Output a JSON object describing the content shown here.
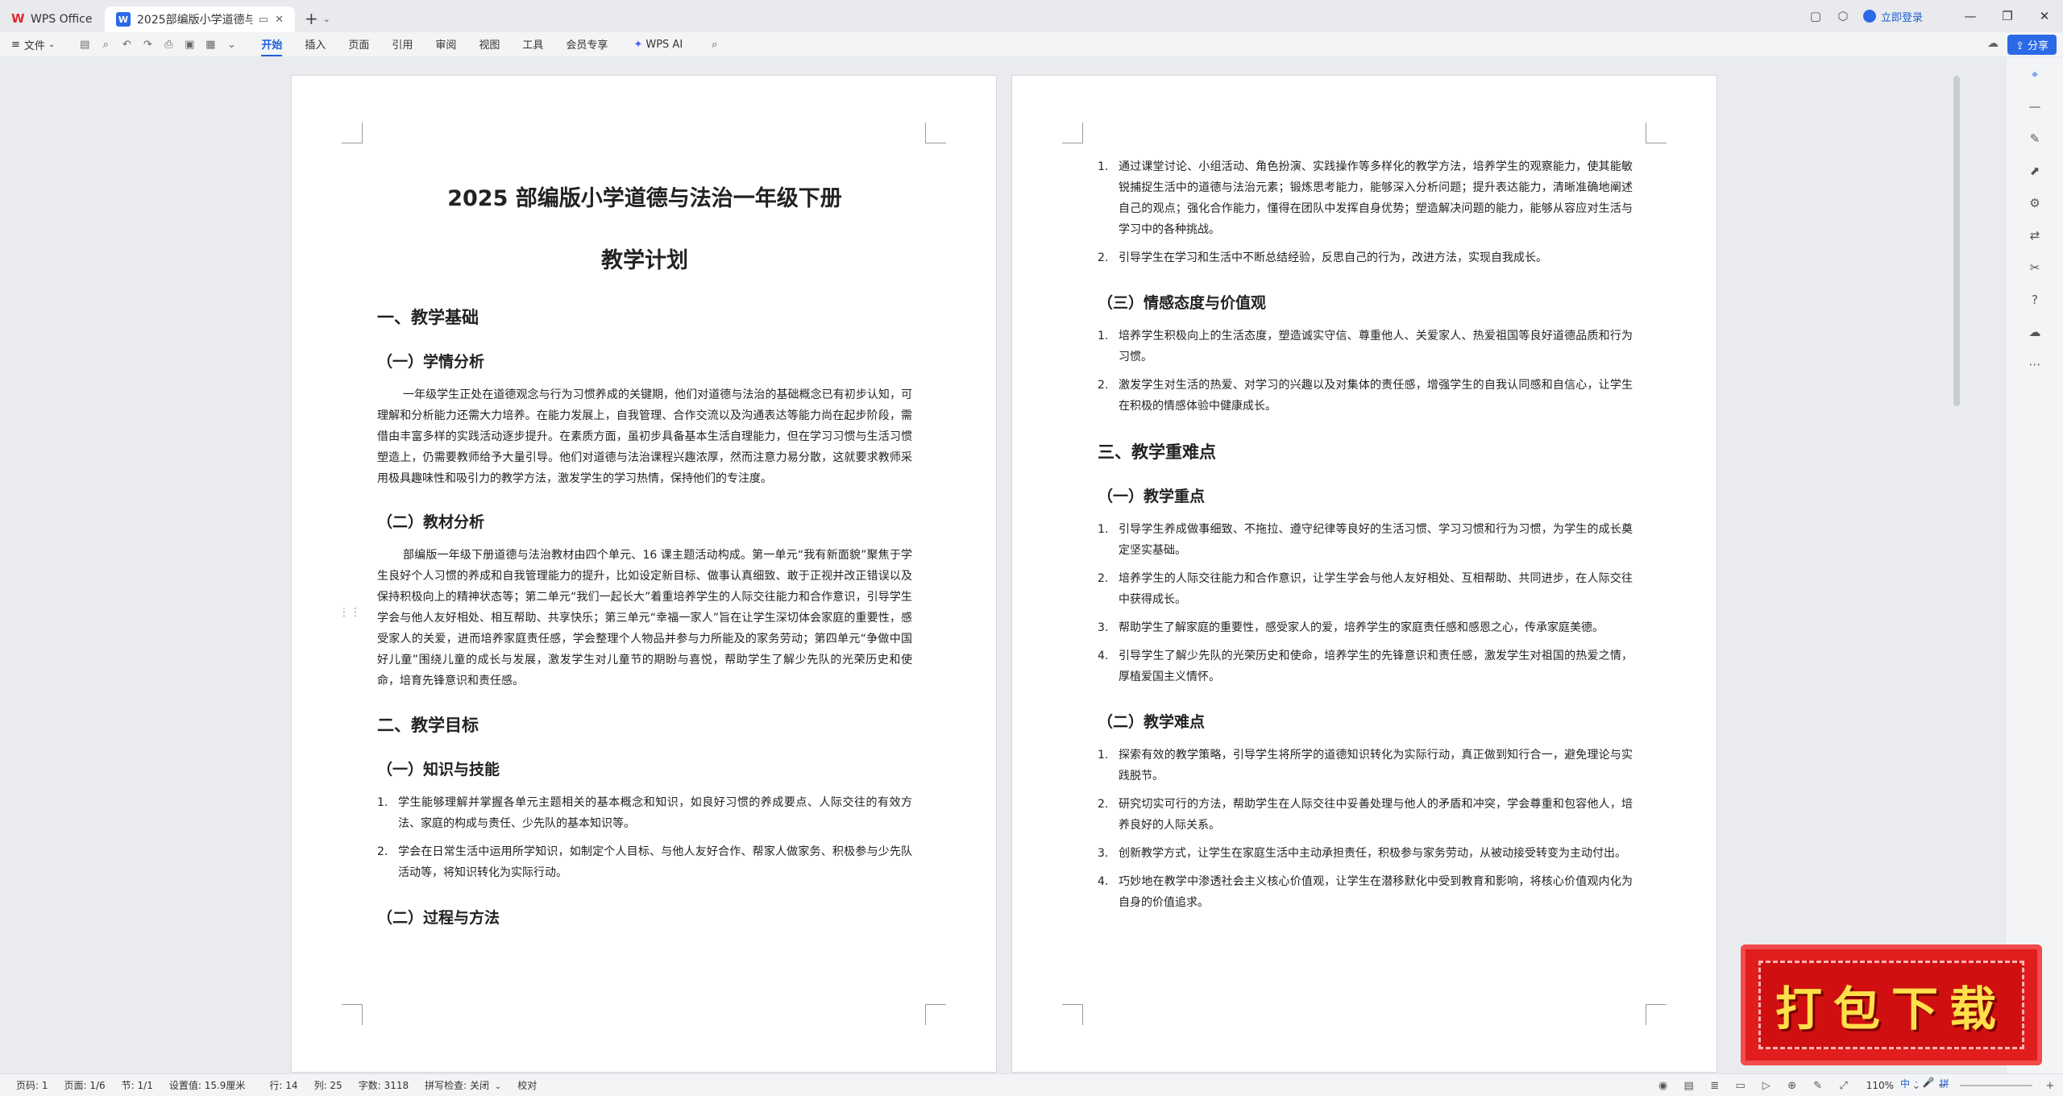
{
  "titlebar": {
    "home_tab": "WPS Office",
    "doc_tab": "2025部编版小学道德与法治",
    "login": "立即登录"
  },
  "toolbar": {
    "file_menu": "文件",
    "menus": [
      "开始",
      "插入",
      "页面",
      "引用",
      "审阅",
      "视图",
      "工具",
      "会员专享"
    ],
    "active_menu": "开始",
    "wps_ai": "WPS AI",
    "share": "分享"
  },
  "page1": {
    "title_line1": "2025 部编版小学道德与法治一年级下册",
    "title_line2": "教学计划",
    "sec1": "一、教学基础",
    "sec1_sub1": "（一）学情分析",
    "sec1_sub1_para": "一年级学生正处在道德观念与行为习惯养成的关键期，他们对道德与法治的基础概念已有初步认知，可理解和分析能力还需大力培养。在能力发展上，自我管理、合作交流以及沟通表达等能力尚在起步阶段，需借由丰富多样的实践活动逐步提升。在素质方面，虽初步具备基本生活自理能力，但在学习习惯与生活习惯塑造上，仍需要教师给予大量引导。他们对道德与法治课程兴趣浓厚，然而注意力易分散，这就要求教师采用极具趣味性和吸引力的教学方法，激发学生的学习热情，保持他们的专注度。",
    "sec1_sub2": "（二）教材分析",
    "sec1_sub2_para": "部编版一年级下册道德与法治教材由四个单元、16 课主题活动构成。第一单元“我有新面貌”聚焦于学生良好个人习惯的养成和自我管理能力的提升，比如设定新目标、做事认真细致、敢于正视并改正错误以及保持积极向上的精神状态等；第二单元“我们一起长大”着重培养学生的人际交往能力和合作意识，引导学生学会与他人友好相处、相互帮助、共享快乐；第三单元“幸福一家人”旨在让学生深切体会家庭的重要性，感受家人的关爱，进而培养家庭责任感，学会整理个人物品并参与力所能及的家务劳动；第四单元“争做中国好儿童”围绕儿童的成长与发展，激发学生对儿童节的期盼与喜悦，帮助学生了解少先队的光荣历史和使命，培育先锋意识和责任感。",
    "sec2": "二、教学目标",
    "sec2_sub1": "（一）知识与技能",
    "sec2_sub1_items": [
      {
        "num": "1.",
        "text": "学生能够理解并掌握各单元主题相关的基本概念和知识，如良好习惯的养成要点、人际交往的有效方法、家庭的构成与责任、少先队的基本知识等。"
      },
      {
        "num": "2.",
        "text": "学会在日常生活中运用所学知识，如制定个人目标、与他人友好合作、帮家人做家务、积极参与少先队活动等，将知识转化为实际行动。"
      }
    ],
    "sec2_sub2": "（二）过程与方法"
  },
  "page2": {
    "top_items": [
      {
        "num": "1.",
        "text": "通过课堂讨论、小组活动、角色扮演、实践操作等多样化的教学方法，培养学生的观察能力，使其能敏锐捕捉生活中的道德与法治元素；锻炼思考能力，能够深入分析问题；提升表达能力，清晰准确地阐述自己的观点；强化合作能力，懂得在团队中发挥自身优势；塑造解决问题的能力，能够从容应对生活与学习中的各种挑战。"
      },
      {
        "num": "2.",
        "text": "引导学生在学习和生活中不断总结经验，反思自己的行为，改进方法，实现自我成长。"
      }
    ],
    "sub3": "（三）情感态度与价值观",
    "sub3_items": [
      {
        "num": "1.",
        "text": "培养学生积极向上的生活态度，塑造诚实守信、尊重他人、关爱家人、热爱祖国等良好道德品质和行为习惯。"
      },
      {
        "num": "2.",
        "text": "激发学生对生活的热爱、对学习的兴趣以及对集体的责任感，增强学生的自我认同感和自信心，让学生在积极的情感体验中健康成长。"
      }
    ],
    "sec3": "三、教学重难点",
    "sec3_sub1": "（一）教学重点",
    "sec3_sub1_items": [
      {
        "num": "1.",
        "text": "引导学生养成做事细致、不拖拉、遵守纪律等良好的生活习惯、学习习惯和行为习惯，为学生的成长奠定坚实基础。"
      },
      {
        "num": "2.",
        "text": "培养学生的人际交往能力和合作意识，让学生学会与他人友好相处、互相帮助、共同进步，在人际交往中获得成长。"
      },
      {
        "num": "3.",
        "text": "帮助学生了解家庭的重要性，感受家人的爱，培养学生的家庭责任感和感恩之心，传承家庭美德。"
      },
      {
        "num": "4.",
        "text": "引导学生了解少先队的光荣历史和使命，培养学生的先锋意识和责任感，激发学生对祖国的热爱之情，厚植爱国主义情怀。"
      }
    ],
    "sec3_sub2": "（二）教学难点",
    "sec3_sub2_items": [
      {
        "num": "1.",
        "text": "探索有效的教学策略，引导学生将所学的道德知识转化为实际行动，真正做到知行合一，避免理论与实践脱节。"
      },
      {
        "num": "2.",
        "text": "研究切实可行的方法，帮助学生在人际交往中妥善处理与他人的矛盾和冲突，学会尊重和包容他人，培养良好的人际关系。"
      },
      {
        "num": "3.",
        "text": "创新教学方式，让学生在家庭生活中主动承担责任，积极参与家务劳动，从被动接受转变为主动付出。"
      },
      {
        "num": "4.",
        "text": "巧妙地在教学中渗透社会主义核心价值观，让学生在潜移默化中受到教育和影响，将核心价值观内化为自身的价值追求。"
      }
    ]
  },
  "statusbar": {
    "page_num": "页码: 1",
    "pages": "页面: 1/6",
    "section": "节: 1/1",
    "setting": "设置值: 15.9厘米",
    "row": "行: 14",
    "col": "列: 25",
    "words": "字数: 3118",
    "spellcheck": "拼写检查: 关闭",
    "proof": "校对",
    "zoom": "110%"
  },
  "banner": {
    "text": "打包下载"
  },
  "ime": [
    "中",
    "·",
    "🎤",
    "拼"
  ],
  "colors": {
    "accent": "#2b6ae6",
    "banner_red": "#e11d1d",
    "banner_text": "#ffe04a"
  }
}
